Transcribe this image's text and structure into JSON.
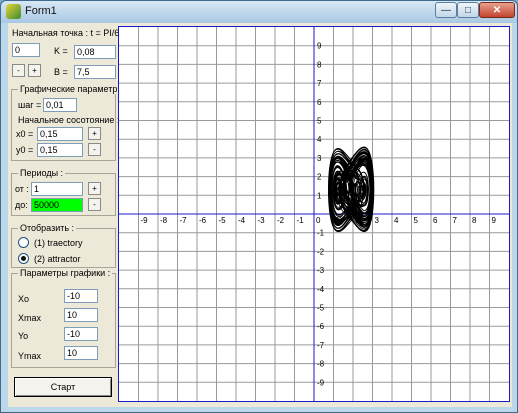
{
  "window": {
    "title": "Form1"
  },
  "start_point": {
    "label": "Начальная точка : t = PI/6*",
    "t_value": "0",
    "k_label": "K =",
    "k_value": "0,08",
    "b_label": "B =",
    "b_value": "7,5",
    "minus": "-",
    "plus": "+"
  },
  "graphic_params": {
    "legend": "Графические параметры",
    "step_label": "шаг =",
    "step_value": "0,01",
    "initial_state_label": "Начальное сосотояние :",
    "x0_label": "x0 =",
    "x0_value": "0,15",
    "y0_label": "y0 =",
    "y0_value": "0,15",
    "plus": "+",
    "minus": "-"
  },
  "periods": {
    "legend": "Периоды :",
    "from_label": "от :",
    "from_value": "1",
    "to_label": "до:",
    "to_value": "50000",
    "to_color": "#00ff00",
    "plus": "+",
    "minus": "-"
  },
  "display": {
    "legend": "Отобразить :",
    "options": [
      {
        "label": "(1)  traectory",
        "selected": false
      },
      {
        "label": "(2)  attractor",
        "selected": true
      }
    ]
  },
  "plot_params": {
    "legend": "Параметры графики :",
    "xo_label": "Xo",
    "xo_value": "-10",
    "xmax_label": "Xmax",
    "xmax_value": "10",
    "yo_label": "Yo",
    "yo_value": "-10",
    "ymax_label": "Ymax",
    "ymax_value": "10"
  },
  "start_button": "Старт",
  "plot": {
    "x_ticks": [
      "-9",
      "-8",
      "-7",
      "-6",
      "-5",
      "-4",
      "-3",
      "-2",
      "-1",
      "0",
      "1",
      "2",
      "3",
      "4",
      "5",
      "6",
      "7",
      "8",
      "9"
    ],
    "y_ticks_pos": [
      "9",
      "8",
      "7",
      "6",
      "5",
      "4",
      "3",
      "2",
      "1"
    ],
    "y_ticks_neg": [
      "-1",
      "-2",
      "-3",
      "-4",
      "-5",
      "-6",
      "-7",
      "-8",
      "-9"
    ],
    "origin_label": "0",
    "range": {
      "xmin": -10,
      "xmax": 10,
      "ymin": -10,
      "ymax": 10
    },
    "grid": true,
    "curve_color": "#000000",
    "axis_color": "#1a1ac8"
  }
}
